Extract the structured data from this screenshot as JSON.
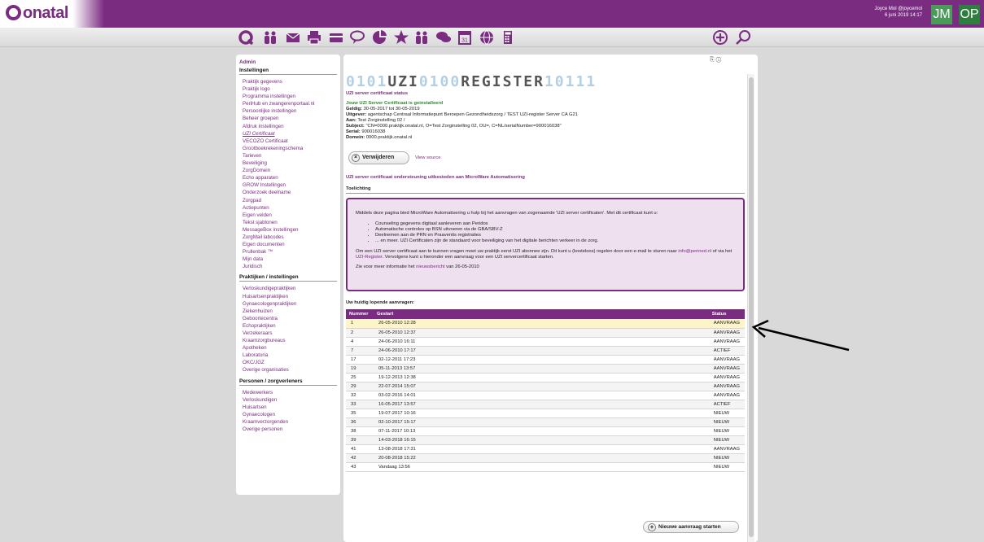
{
  "header": {
    "logo_text": "onatal",
    "user_name": "Joyce Mol @joycemol",
    "user_date": "6 juni 2019 14:17",
    "btn_jm": "JM",
    "btn_op": "OP"
  },
  "toolbar": {
    "icons": [
      "onatal-logo-icon",
      "people-icon",
      "mail-icon",
      "printer-icon",
      "card-icon",
      "chat-icon",
      "chart-icon",
      "star-icon",
      "group-icon",
      "comments-icon",
      "calendar-icon",
      "globe-icon",
      "calculator-icon"
    ],
    "add_glyph": "⊕",
    "search_glyph": "⚲"
  },
  "sidebar": {
    "admin": "Admin",
    "sections": [
      {
        "title": "Instellingen",
        "items": [
          "Praktijk gegevens",
          "Praktijk logo",
          "Programma instellingen",
          "PeriHub en zwangerenportaal.nl",
          "Persoonlijke instellingen",
          "Beheer groepen",
          "Afdruk instellingen",
          "UZI Certificaat",
          "VECOZO Certificaat",
          "Grootboekrekeningschema",
          "Tarieven",
          "Beveiliging",
          "ZorgDomein",
          "Echo apparaten",
          "GROW Instellingen",
          "Onderzoek deelname",
          "Zorgpad",
          "Actiepunten",
          "Eigen velden",
          "Tekst sjablonen",
          "MessageBox instellingen",
          "ZorgMail labcodes",
          "Eigen documenten",
          "Prullenbak ™",
          "Mijn data",
          "Juridisch"
        ]
      },
      {
        "title": "Praktijken / instellingen",
        "items": [
          "Verloskundigepraktijken",
          "Huisartsenpraktijken",
          "Gynaecologenpraktijken",
          "Ziekenhuizen",
          "Geboortecentra",
          "Echopraktijken",
          "Verzekeraars",
          "Kraamzorgbureaus",
          "Apotheken",
          "Laboratoria",
          "OKC/JGZ",
          "Overige organisaties"
        ]
      },
      {
        "title": "Personen / zorgverleners",
        "items": [
          "Medewerkers",
          "Verloskundigen",
          "Huisartsen",
          "Gynaecologen",
          "Kraamverzorgenden",
          "Overige personen"
        ]
      }
    ],
    "active_item": "UZI Certificaat"
  },
  "main": {
    "banner": {
      "p1": "0101",
      "p2": "UZI",
      "p3": "0100",
      "p4": "REGISTER",
      "p5": "10111"
    },
    "status_title": "UZI server certificaat status",
    "installed": "Jouw UZI Server Certificaat is geinstalleerd",
    "geldig_label": "Geldig:",
    "geldig_value": " 30-05-2017 tot 30-05-2019",
    "uitgever_label": "Uitgever:",
    "uitgever_value": " agentschap Centraal Informatiepunt Beroepen Gezondheidszorg / TEST UZI-register Server CA G21",
    "aan_label": "Aan:",
    "aan_value": " Test Zorginstelling 02 /",
    "subject_label": "Subject:",
    "subject_value": " \"CN=0000.praktijk.onatal.nl, O=Test Zorginstelling 02, OU=, C=NL/serialNumber=900016038\"",
    "serial_label": "Serial:",
    "serial_value": " 900016038",
    "domein_label": "Domein:",
    "domein_value": " 0000.praktijk.onatal.nl",
    "remove_button": "Verwijderen",
    "view_source": "View source",
    "outsource_title": "UZI server certificaat ondersteuning uitbesteden aan MicroWare Automatisering",
    "toelichting": "Toelichting",
    "info_intro": "Middels deze pagina bied MicroWare Automatisering u hulp bij het aanvragen van zogenaamde 'UZI server certificaten'. Met dit certificaat kunt u:",
    "info_bullets": [
      "Counseling gegevens digitaal aanleveren aan Peridos",
      "Automatische controles op BSN uitvoeren via de GBA/SBV-Z",
      "Deelnemen aan de PRN en Praaventis registraties",
      "... en meer. UZI Certificaten zijn de standaard voor beveiliging van het digitale berichten verkeer in de zorg."
    ],
    "info_p2_a": "Om een UZI server certificaat aan te kunnen vragen moet uw praktijk eerst UZI abonnee zijn. Dit kunt u (kosteloos) regelen door een e-mail te sturen naar ",
    "info_p2_link1": "info@perined.nl",
    "info_p2_b": " of via het ",
    "info_p2_link2": "UZI-Register",
    "info_p2_c": ". Vervolgens kunt u hieronder een aanvraag voor een UZI servercertificaat starten.",
    "info_p3_a": "Zie voor meer informatie het ",
    "info_p3_link": "nieuwsbericht",
    "info_p3_b": " van 26-05-2010",
    "running_title": "Uw huidig lopende aanvragen:",
    "table_headers": {
      "nummer": "Nummer",
      "gestart": "Gestart",
      "status": "Status"
    },
    "rows": [
      {
        "nr": "1",
        "date": "26-05-2010 12:28",
        "status": "AANVRAAG"
      },
      {
        "nr": "2",
        "date": "26-05-2010 12:37",
        "status": "AANVRAAG"
      },
      {
        "nr": "4",
        "date": "24-06-2010 16:11",
        "status": "AANVRAAG"
      },
      {
        "nr": "7",
        "date": "24-06-2010 17:17",
        "status": "ACTIEF"
      },
      {
        "nr": "17",
        "date": "02-12-2011 17:23",
        "status": "AANVRAAG"
      },
      {
        "nr": "19",
        "date": "05-11-2013 13:57",
        "status": "AANVRAAG"
      },
      {
        "nr": "25",
        "date": "19-12-2013 12:38",
        "status": "AANVRAAG"
      },
      {
        "nr": "29",
        "date": "22-07-2014 15:07",
        "status": "AANVRAAG"
      },
      {
        "nr": "32",
        "date": "03-02-2016 14:01",
        "status": "AANVRAAG"
      },
      {
        "nr": "33",
        "date": "16-05-2017 13:57",
        "status": "ACTIEF"
      },
      {
        "nr": "35",
        "date": "19-07-2017 10:16",
        "status": "NIEUW"
      },
      {
        "nr": "36",
        "date": "02-10-2017 15:17",
        "status": "NIEUW"
      },
      {
        "nr": "38",
        "date": "07-11-2017 10:13",
        "status": "NIEUW"
      },
      {
        "nr": "39",
        "date": "14-03-2018 16:15",
        "status": "NIEUW"
      },
      {
        "nr": "41",
        "date": "13-08-2018 17:31",
        "status": "AANVRAAG"
      },
      {
        "nr": "42",
        "date": "20-08-2018 15:22",
        "status": "NIEUW"
      },
      {
        "nr": "43",
        "date": "Vandaag 13:56",
        "status": "NIEUW"
      }
    ],
    "new_request_button": "Nieuwe aanvraag starten"
  },
  "colors": {
    "brand": "#7a2c80",
    "highlight_row": "#fdf4c8",
    "info_bg": "#efe0ef"
  }
}
